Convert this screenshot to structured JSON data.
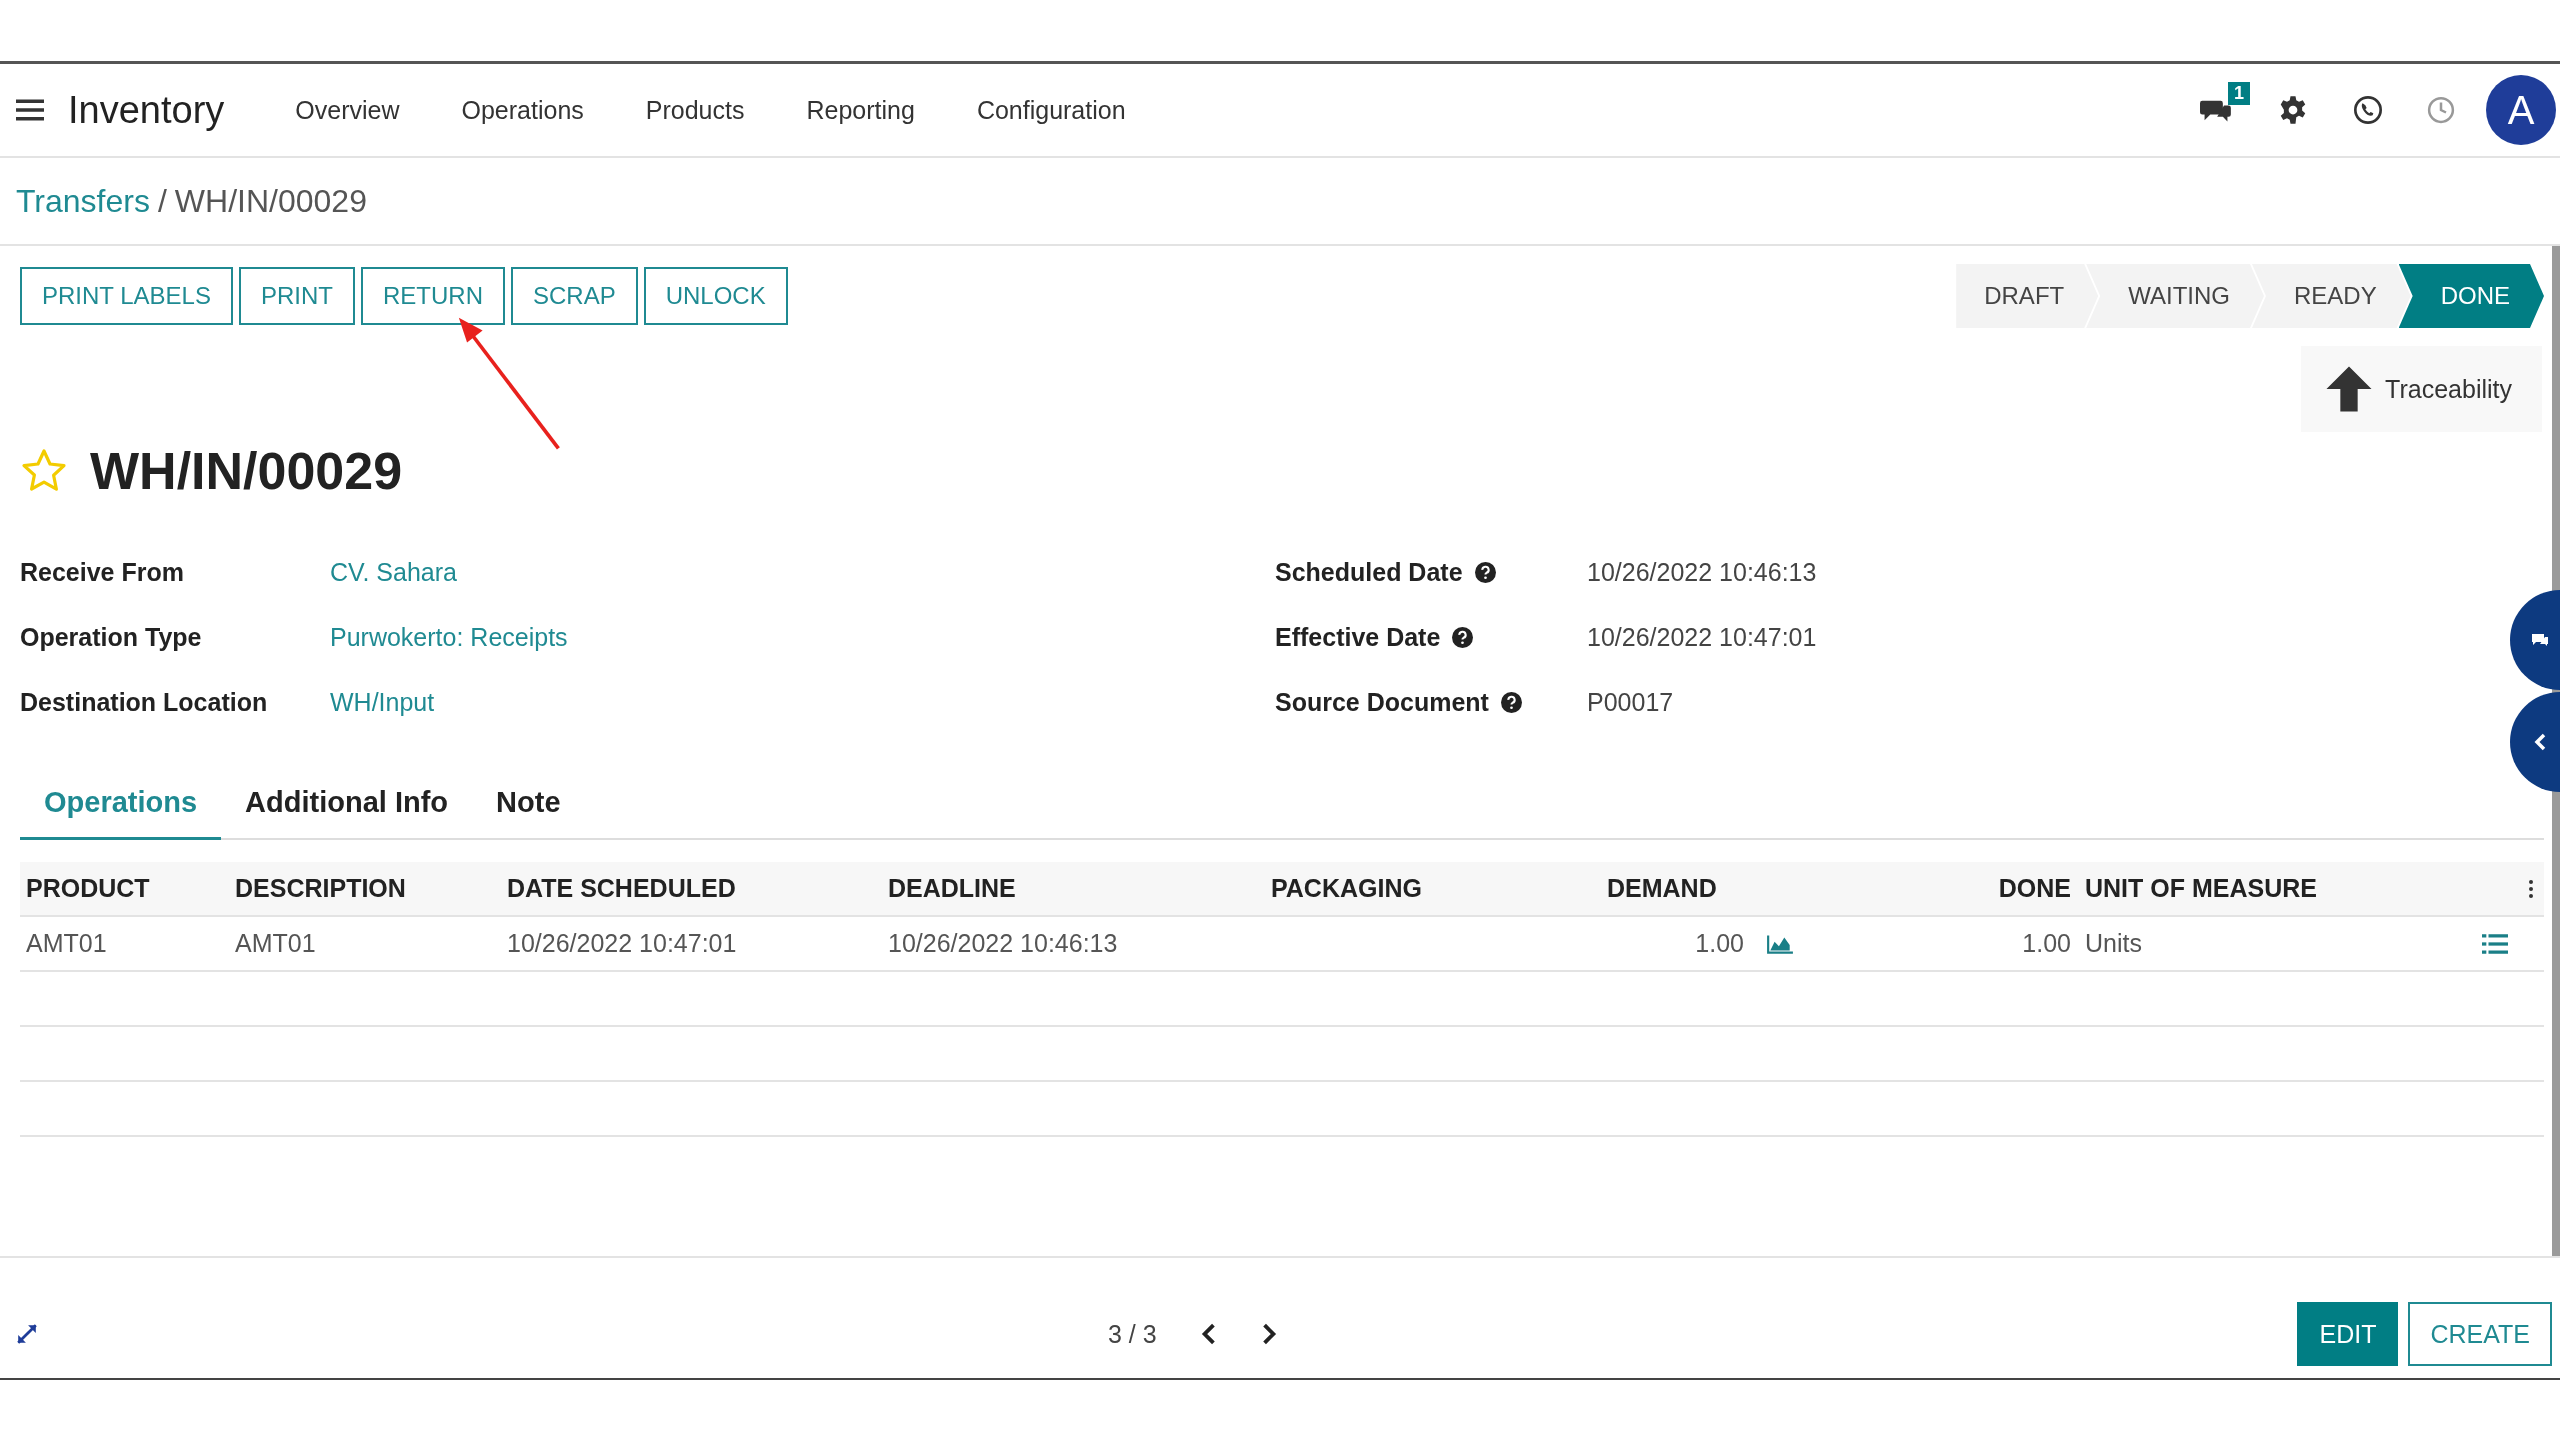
{
  "app": {
    "name": "Inventory",
    "menu": [
      "Overview",
      "Operations",
      "Products",
      "Reporting",
      "Configuration"
    ],
    "message_count": "1",
    "avatar": "A"
  },
  "breadcrumb": {
    "parent": "Transfers",
    "separator": "/",
    "current": "WH/IN/00029"
  },
  "actions": [
    "PRINT LABELS",
    "PRINT",
    "RETURN",
    "SCRAP",
    "UNLOCK"
  ],
  "stages": [
    {
      "label": "DRAFT",
      "selected": false
    },
    {
      "label": "WAITING",
      "selected": false
    },
    {
      "label": "READY",
      "selected": false
    },
    {
      "label": "DONE",
      "selected": true
    }
  ],
  "smart_button": "Traceability",
  "record": {
    "title": "WH/IN/00029",
    "favorite": false
  },
  "fields_left": [
    {
      "label": "Receive From",
      "value": "CV. Sahara"
    },
    {
      "label": "Operation Type",
      "value": "Purwokerto: Receipts"
    },
    {
      "label": "Destination Location",
      "value": "WH/Input"
    }
  ],
  "fields_right": [
    {
      "label": "Scheduled Date",
      "value": "10/26/2022 10:46:13"
    },
    {
      "label": "Effective Date",
      "value": "10/26/2022 10:47:01"
    },
    {
      "label": "Source Document",
      "value": "P00017"
    }
  ],
  "tabs": [
    {
      "label": "Operations",
      "selected": true
    },
    {
      "label": "Additional Info",
      "selected": false
    },
    {
      "label": "Note",
      "selected": false
    }
  ],
  "table": {
    "columns": [
      "PRODUCT",
      "DESCRIPTION",
      "DATE SCHEDULED",
      "DEADLINE",
      "PACKAGING",
      "DEMAND",
      "DONE",
      "UNIT OF MEASURE"
    ],
    "rows": [
      {
        "product": "AMT01",
        "description": "AMT01",
        "date_scheduled": "10/26/2022 10:47:01",
        "deadline": "10/26/2022 10:46:13",
        "demand": "1.00",
        "done": "1.00",
        "uom": "Units"
      }
    ]
  },
  "pager": "3 / 3",
  "buttons": [
    "EDIT",
    "CREATE"
  ]
}
